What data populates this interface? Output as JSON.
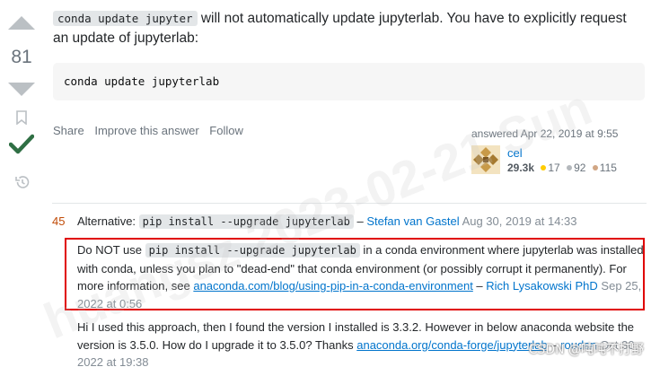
{
  "vote": {
    "score": "81"
  },
  "answer": {
    "intro_code": "conda update jupyter",
    "intro_text": " will not automatically update jupyterlab. You have to explicitly request an update of jupyterlab:",
    "code_block": "conda update jupyterlab"
  },
  "menu": {
    "share": "Share",
    "improve": "Improve this answer",
    "follow": "Follow"
  },
  "user_card": {
    "answered": "answered Apr 22, 2019 at 9:55",
    "name": "cel",
    "reputation": "29.3k",
    "gold": "17",
    "silver": "92",
    "bronze": "115",
    "colors": {
      "gold": "#ffcc01",
      "silver": "#b4b8bc",
      "bronze": "#d1a684"
    }
  },
  "comments": [
    {
      "score": "45",
      "label": "Alternative: ",
      "code": "pip install --upgrade jupyterlab",
      "dash": " – ",
      "user": "Stefan van Gastel",
      "date": "Aug 30, 2019 at 14:33"
    },
    {
      "pre": "Do NOT use ",
      "code": "pip install --upgrade jupyterlab",
      "text1": " in a conda environment where jupyterlab was installed with conda, unless you plan to \"dead-end\" that conda environment (or possibly corrupt it permanently). For more information, see ",
      "link": "anaconda.com/blog/using-pip-in-a-conda-environment",
      "dash": " – ",
      "user": "Rich Lysakowski PhD",
      "date": "Sep 25, 2022 at 0:56"
    },
    {
      "text1": "Hi I used this approach, then I found the version I installed is 3.3.2. However in below anaconda website the version is 3.5.0. How do I upgrade it to 3.5.0? Thanks ",
      "link": "anaconda.org/conda-forge/jupyterlab",
      "dash": " – ",
      "user": "roudan",
      "date": "Oct 30, 2022 at 19:38"
    }
  ],
  "watermark": "huangsz 2023-02-21 Sun",
  "csdn": "CSDN @吨吨不打野",
  "accent_colors": {
    "accepted": "#2f6f44",
    "highlight_border": "#e00000",
    "link": "#0074cc"
  }
}
